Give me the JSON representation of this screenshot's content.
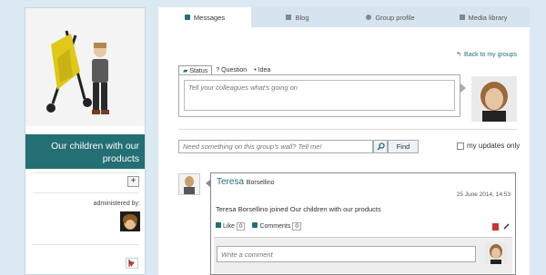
{
  "sidebar": {
    "group_title": "Our children with our products",
    "add_label": "+",
    "administered_by": "administered by:"
  },
  "tabs": [
    {
      "label": "Messages",
      "icon": "speech-bubble-icon",
      "active": true
    },
    {
      "label": "Blog",
      "icon": "document-icon",
      "active": false
    },
    {
      "label": "Group profile",
      "icon": "user-icon",
      "active": false
    },
    {
      "label": "Media library",
      "icon": "image-icon",
      "active": false
    }
  ],
  "back_link": "Back to my groups",
  "post_types": [
    {
      "label": "Status",
      "active": true
    },
    {
      "label": "Question",
      "active": false
    },
    {
      "label": "Idea",
      "active": false
    }
  ],
  "status_placeholder": "Tell your colleagues what's going on",
  "wall_search_placeholder": "Need something on this group's wall? Tell me!",
  "find_label": "Find",
  "my_updates_label": "my updates only",
  "post": {
    "author_first": "Teresa",
    "author_last": "Borsellino",
    "date": "25 June 2014, 14:53",
    "text": "Teresa Borsellino joined Our children with our products",
    "like_label": "Like",
    "like_count": "0",
    "comments_label": "Comments",
    "comments_count": "0",
    "comment_placeholder": "Write a comment"
  },
  "colors": {
    "accent": "#236f74",
    "background": "#dbe9f3",
    "tab_bar": "#d6e4ef"
  }
}
